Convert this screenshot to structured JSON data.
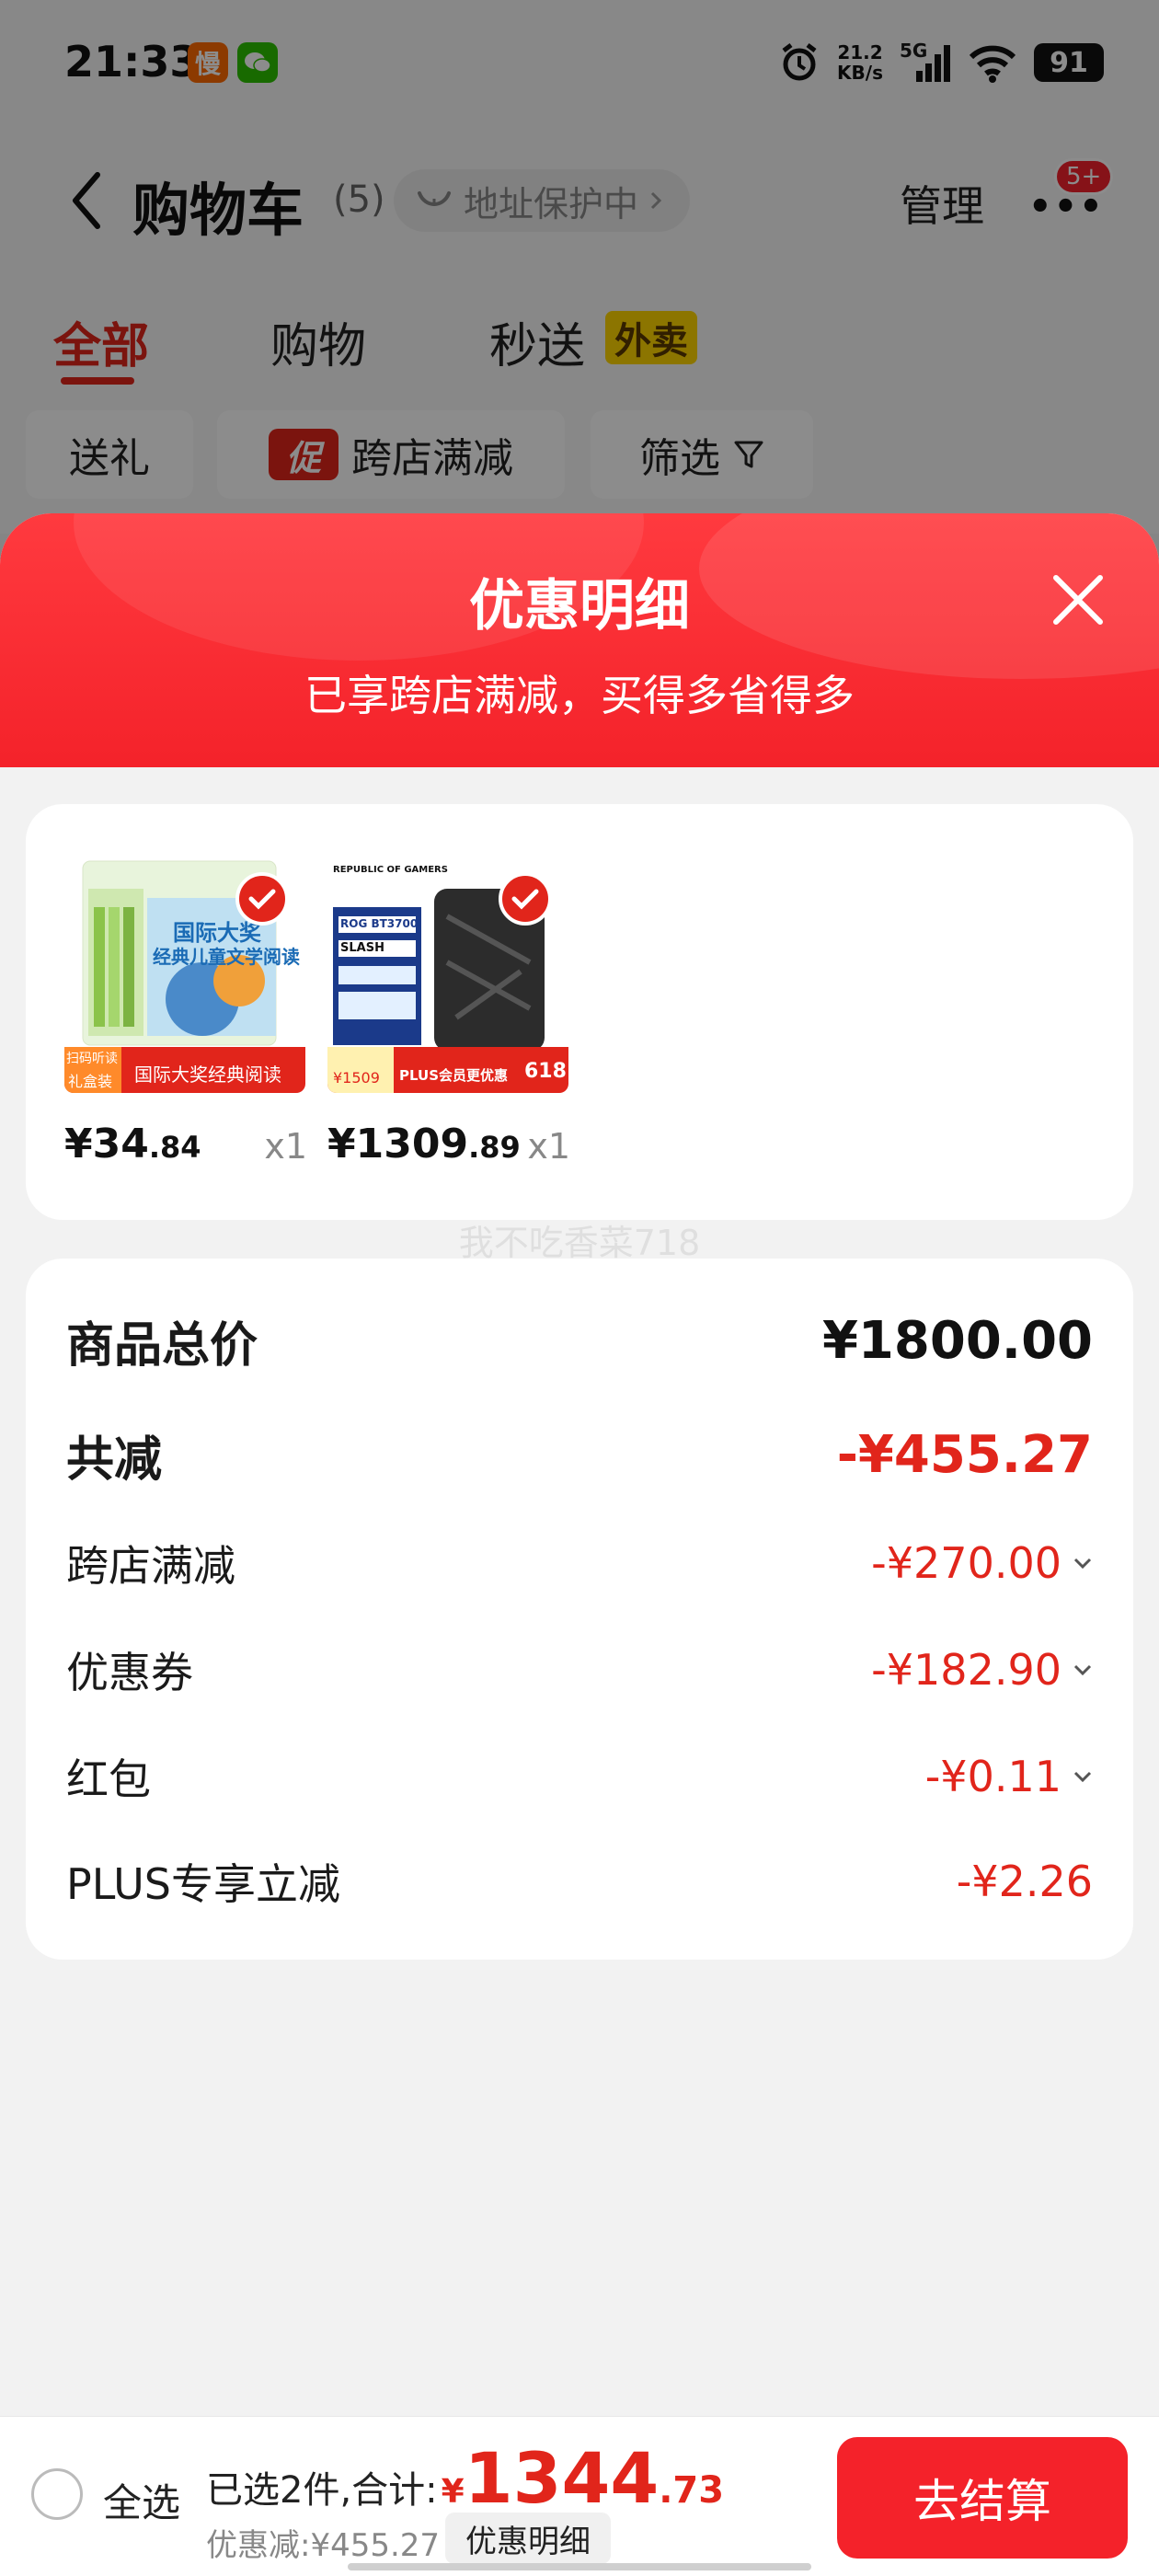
{
  "status_bar": {
    "time": "21:33",
    "net_speed_value": "21.2",
    "net_speed_unit": "KB/s",
    "signal_label": "5G",
    "battery": "91",
    "icons": [
      "app-icon-slow",
      "wechat-icon",
      "alarm-icon",
      "signal-icon",
      "wifi-icon",
      "battery-icon"
    ]
  },
  "app_icon_text": "慢",
  "header": {
    "title": "购物车",
    "count": "(5)",
    "address_protect": "地址保护中",
    "manage": "管理",
    "more_badge": "5+"
  },
  "tabs": [
    {
      "label": "全部",
      "active": true
    },
    {
      "label": "购物",
      "active": false
    },
    {
      "label": "秒送",
      "active": false
    }
  ],
  "takeout_badge": "外卖",
  "chips": {
    "gift": "送礼",
    "promo_tag": "促",
    "cross_store": "跨店满减",
    "filter": "筛选"
  },
  "sheet": {
    "title": "优惠明细",
    "subtitle": "已享跨店满减，买得多省得多"
  },
  "products": [
    {
      "price_int": "¥34",
      "price_dec": ".84",
      "qty": "x1",
      "img": {
        "heading1": "国际大奖",
        "heading2": "经典儿童文学阅读",
        "tag1": "扫码听读",
        "tag2": "礼盒装",
        "banner": "国际大奖经典阅读"
      }
    },
    {
      "price_int": "¥1309",
      "price_dec": ".89",
      "qty": "x1",
      "img": {
        "brand": "REPUBLIC OF GAMERS",
        "model": "ROG BT3700",
        "slash": "SLASH",
        "price_tag": "¥1509",
        "banner": "PLUS会员更优惠",
        "badge": "618"
      }
    }
  ],
  "watermark": "我不吃香菜718",
  "summary": {
    "total_label": "商品总价",
    "total_value": "¥1800.00",
    "saved_label": "共减",
    "saved_value": "-¥455.27",
    "items": [
      {
        "label": "跨店满减",
        "value": "-¥270.00",
        "expandable": true
      },
      {
        "label": "优惠券",
        "value": "-¥182.90",
        "expandable": true
      },
      {
        "label": "红包",
        "value": "-¥0.11",
        "expandable": true
      },
      {
        "label": "PLUS专享立减",
        "value": "-¥2.26",
        "expandable": false
      }
    ]
  },
  "bottom_bar": {
    "select_all": "全选",
    "selected_text": "已选2件,合计:",
    "total_yen": "¥",
    "total_int": "1344",
    "total_dec": ".73",
    "saved_text": "优惠减:¥455.27",
    "detail_button": "优惠明细",
    "checkout": "去结算"
  },
  "colors": {
    "brand_red": "#e1251b",
    "sheet_header_red": "#f4222a",
    "takeout_yellow": "#ffd600"
  }
}
